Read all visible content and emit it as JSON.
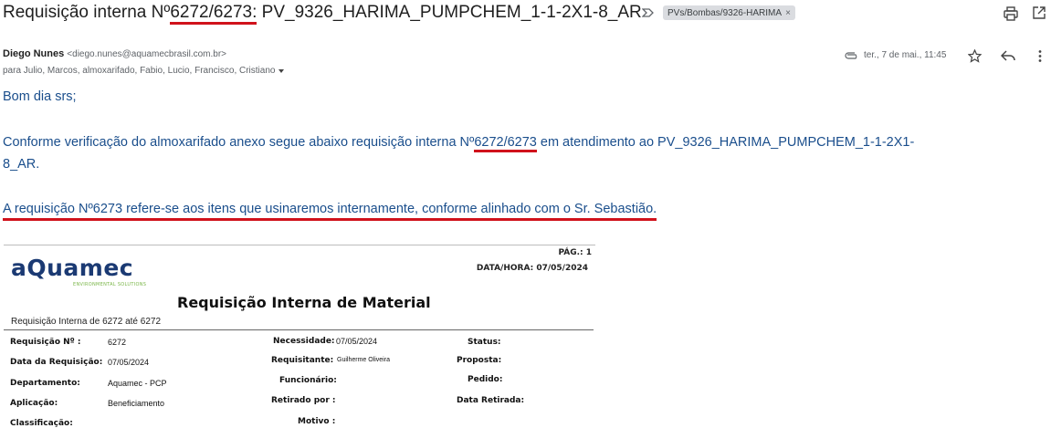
{
  "subject": {
    "prefix": "Requisição interna Nº",
    "numbers": "6272/6273:",
    "rest": " PV_9326_HARIMA_PUMPCHEM_1-1-2X1-8_AR",
    "label": "PVs/Bombas/9326-HARIMA",
    "label_remove": "×"
  },
  "message": {
    "sender_name": "Diego Nunes",
    "sender_email": "<diego.nunes@aquamecbrasil.com.br>",
    "recipients": "para Julio, Marcos, almoxarifado, Fabio, Lucio, Francisco, Cristiano",
    "date": "ter., 7 de mai., 11:45"
  },
  "body": {
    "greeting": "Bom dia srs;",
    "line1_a": "Conforme verificação do almoxarifado anexo segue abaixo requisição interna Nº",
    "line1_num": "6272/6273",
    "line1_b": " em atendimento ao PV_9326_HARIMA_PUMPCHEM_1-1-2X1-",
    "line2": "8_AR.",
    "line3": "A requisição Nº6273 refere-se aos itens que usinaremos internamente, conforme alinhado com o Sr. Sebastião."
  },
  "document": {
    "logo": "aQuamec",
    "logo_sub": "ENVIRONMENTAL SOLUTIONS",
    "page": "PÁG.: 1",
    "datetime": "DATA/HORA: 07/05/2024",
    "title": "Requisição Interna de Material",
    "range": "Requisição Interna de 6272 até 6272",
    "fields": {
      "req_no_label": "Requisição Nº :",
      "req_no_value": "6272",
      "data_req_label": "Data da Requisição:",
      "data_req_value": "07/05/2024",
      "departamento_label": "Departamento:",
      "departamento_value": "Aquamec - PCP",
      "aplicacao_label": "Aplicação:",
      "aplicacao_value": "Beneficiamento",
      "classificacao_label": "Classificação:",
      "necessidade_label": "Necessidade:",
      "necessidade_value": "07/05/2024",
      "requisitante_label": "Requisitante:",
      "requisitante_value": "Guilherme Oliveira",
      "funcionario_label": "Funcionário:",
      "retirado_label": "Retirado por :",
      "motivo_label": "Motivo :",
      "status_label": "Status:",
      "proposta_label": "Proposta:",
      "pedido_label": "Pedido:",
      "data_retirada_label": "Data Retirada:"
    }
  },
  "colors": {
    "body_text": "#1a4e8c",
    "underline": "#d0121b",
    "logo_blue": "#1b3a73",
    "logo_green": "#7ab648"
  },
  "icons": [
    "important-marker-icon",
    "print-icon",
    "open-new-window-icon",
    "attachment-icon",
    "star-icon",
    "reply-icon",
    "more-vert-icon",
    "dropdown-arrow-icon"
  ]
}
